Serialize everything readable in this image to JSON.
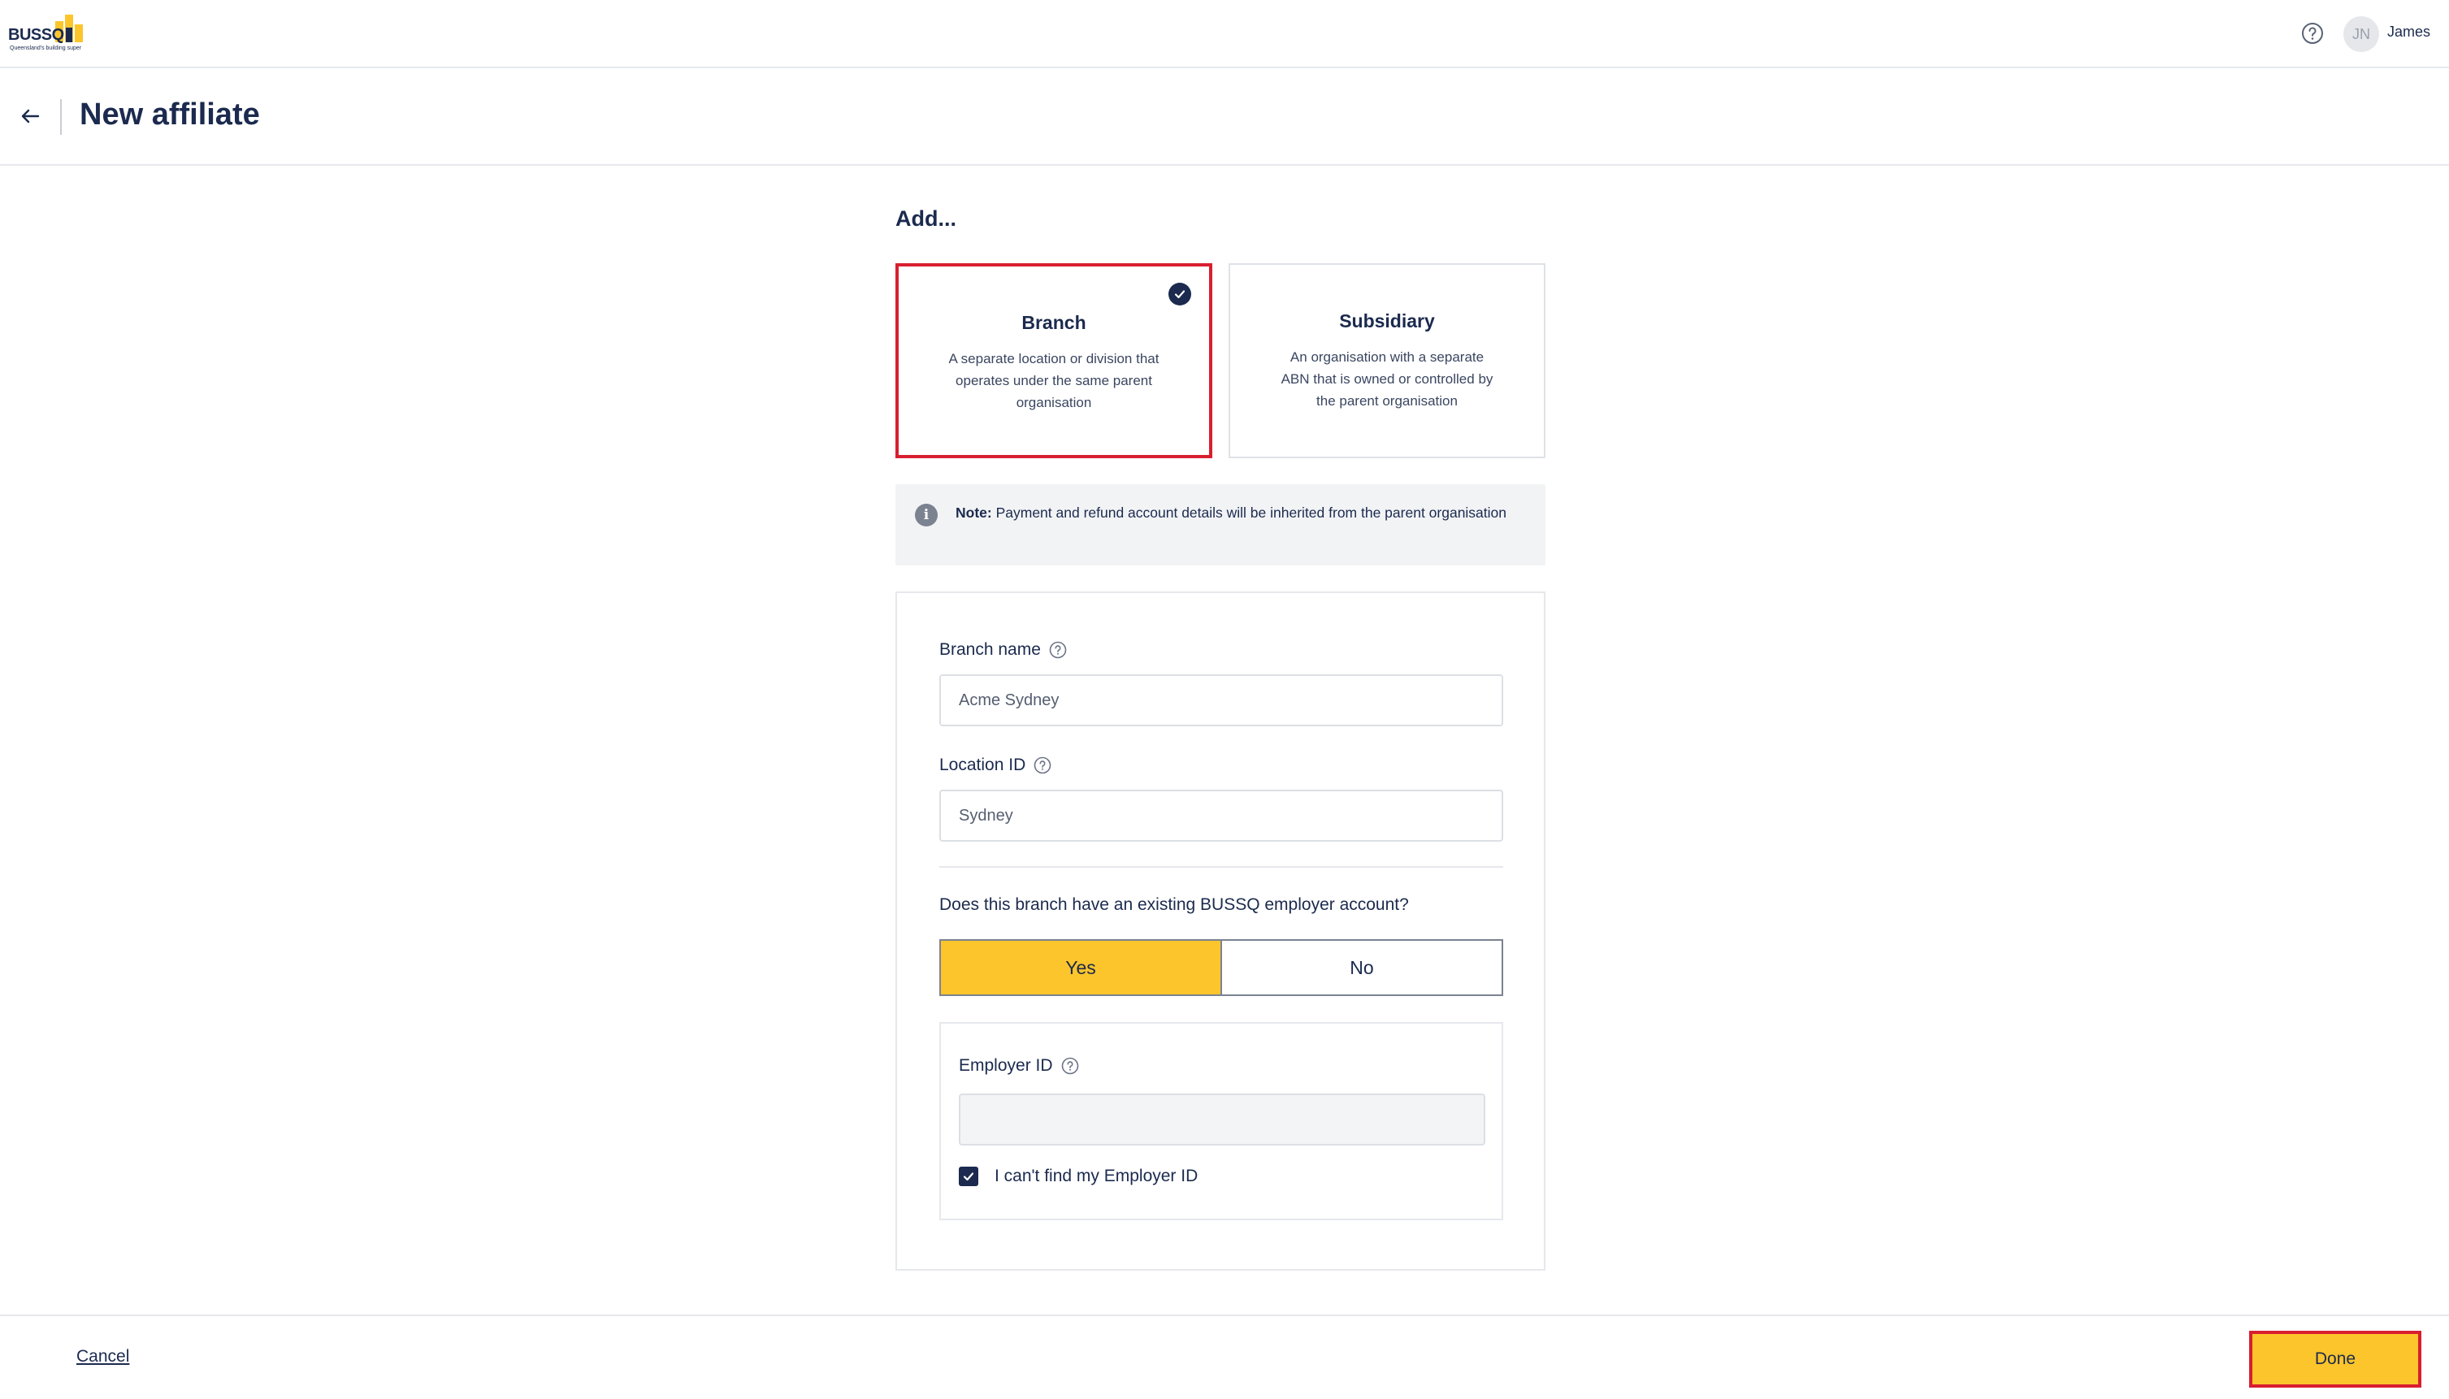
{
  "app": {
    "logo_text": "BUSSQ",
    "logo_tagline": "Queensland's building super"
  },
  "topbar": {
    "help_icon": "help-circle-icon",
    "avatar_initials": "JN",
    "user_name": "James"
  },
  "header": {
    "back_icon": "arrow-left-icon",
    "title": "New affiliate"
  },
  "selection": {
    "heading": "Add...",
    "options": [
      {
        "title": "Branch",
        "description": "A separate location or division that operates under the same parent organisation",
        "selected": true
      },
      {
        "title": "Subsidiary",
        "description": "An organisation with a separate ABN that is owned or controlled by the parent organisation",
        "selected": false
      }
    ]
  },
  "note": {
    "icon": "info-icon",
    "label": "Note:",
    "text": " Payment and refund account details will be inherited from the parent organisation"
  },
  "form": {
    "branch_name": {
      "label": "Branch name",
      "value": "Acme Sydney"
    },
    "location_id": {
      "label": "Location ID",
      "value": "Sydney"
    },
    "existing_account": {
      "question": "Does this branch have an existing BUSSQ employer account?",
      "options": [
        "Yes",
        "No"
      ],
      "selected": "Yes"
    },
    "employer_id": {
      "label": "Employer ID",
      "value": ""
    },
    "cant_find": {
      "label": "I can't find my Employer ID",
      "checked": true
    }
  },
  "footer": {
    "cancel_label": "Cancel",
    "done_label": "Done"
  },
  "colors": {
    "navy": "#1b2a4e",
    "accent_yellow": "#fcc52b",
    "highlight_red": "#d81f2f"
  }
}
